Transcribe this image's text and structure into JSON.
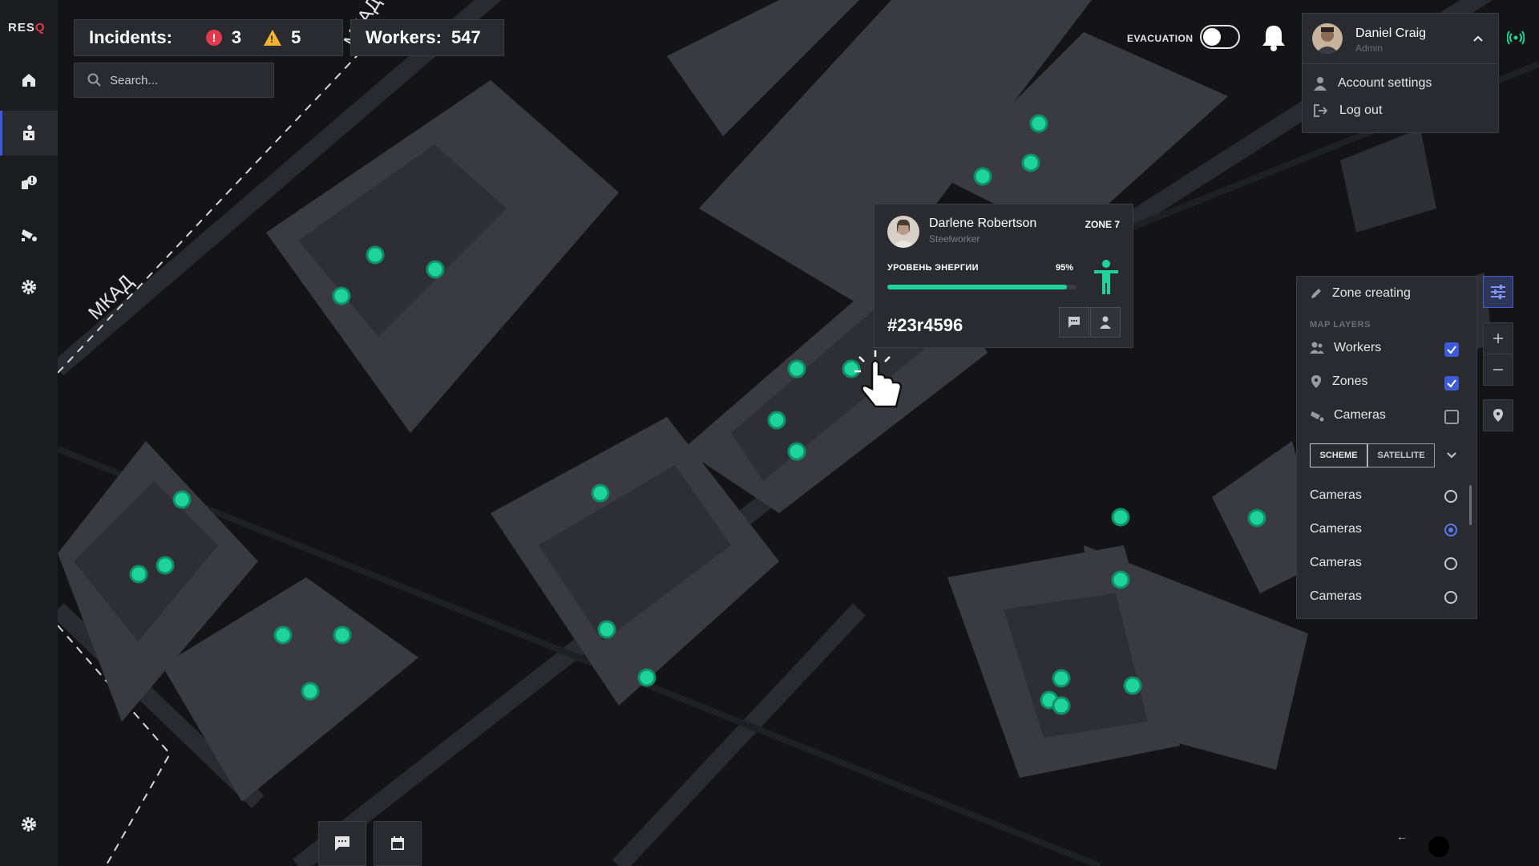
{
  "app": {
    "logo_text": "RES",
    "logo_accent": "Q"
  },
  "header": {
    "incidents_label": "Incidents:",
    "incidents_critical": "3",
    "incidents_warning": "5",
    "warning_mark": "!",
    "critical_mark": "!",
    "workers_label": "Workers:",
    "workers_count": "547"
  },
  "search": {
    "placeholder": "Search..."
  },
  "evacuation": {
    "label": "EVACUATION",
    "enabled": false
  },
  "user": {
    "name": "Daniel Craig",
    "role": "Admin",
    "menu": [
      {
        "label": "Account settings"
      },
      {
        "label": "Log out"
      }
    ]
  },
  "map": {
    "road_labels": [
      "МКАД",
      "МКАД"
    ]
  },
  "worker_card": {
    "name": "Darlene Robertson",
    "role": "Steelworker",
    "zone": "ZONE 7",
    "energy_label": "УРОВЕНЬ ЭНЕРГИИ",
    "energy_percent": 95,
    "energy_text": "95%",
    "id": "#23r4596"
  },
  "layers_panel": {
    "zone_creating": "Zone creating",
    "section_title": "MAP LAYERS",
    "layers": [
      {
        "label": "Workers",
        "checked": true
      },
      {
        "label": "Zones",
        "checked": true
      },
      {
        "label": "Cameras",
        "checked": false
      }
    ],
    "view_modes": [
      "SCHEME",
      "SATELLITE"
    ],
    "options": [
      {
        "label": "Cameras",
        "selected": false
      },
      {
        "label": "Cameras",
        "selected": true
      },
      {
        "label": "Cameras",
        "selected": false
      },
      {
        "label": "Cameras",
        "selected": false
      }
    ]
  },
  "colors": {
    "accent": "#3d5bd6",
    "worker_dot": "#1ed49a",
    "alert": "#e23a4c",
    "warning": "#f2b330"
  }
}
